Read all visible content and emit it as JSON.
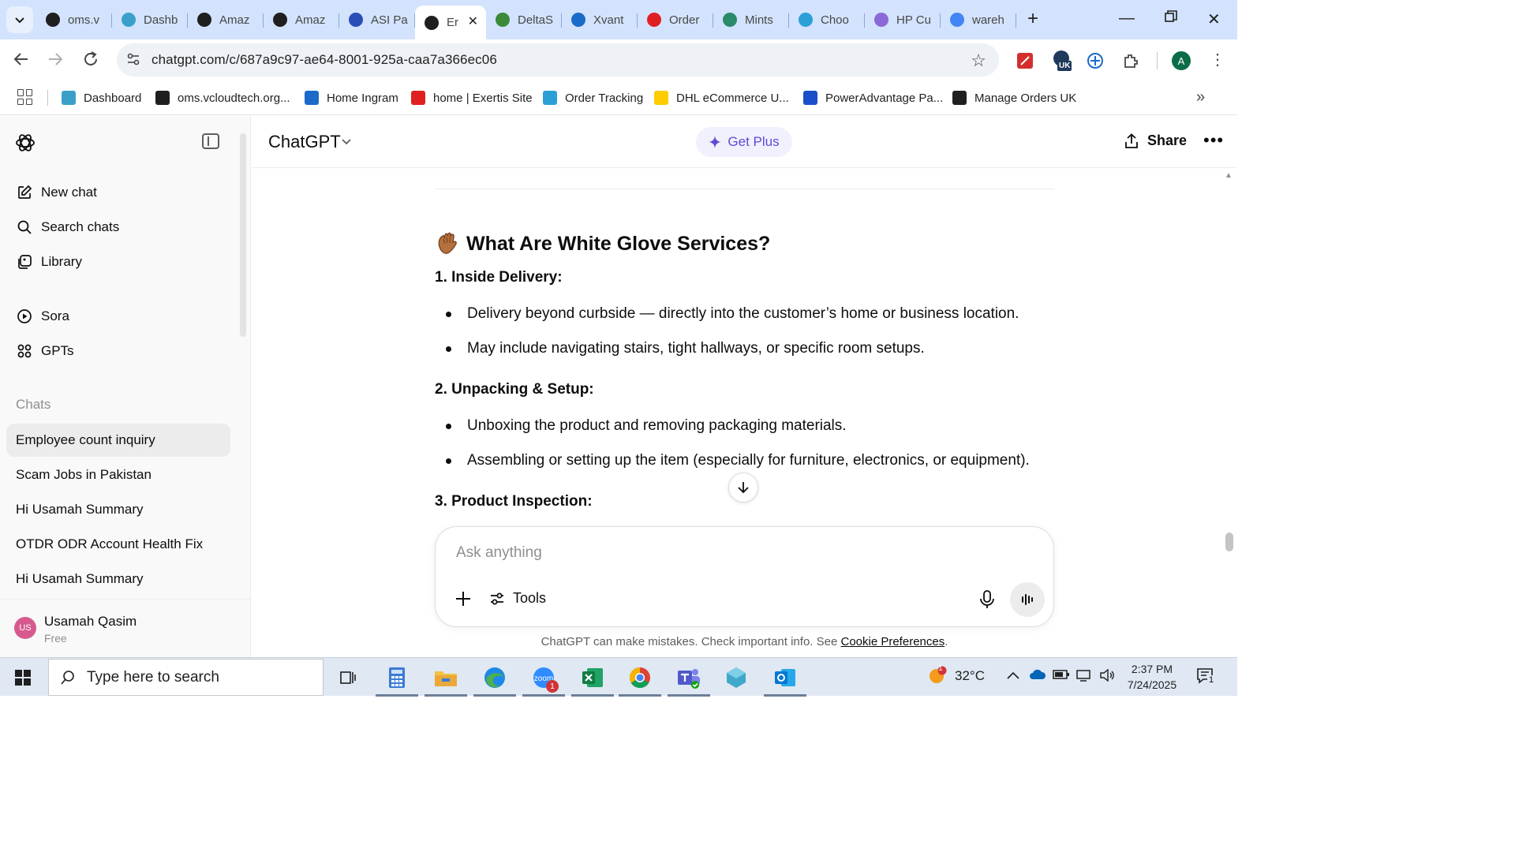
{
  "browser": {
    "tabs": [
      {
        "label": "oms.v",
        "icon": "oms-icon",
        "color": "#1f1f1f"
      },
      {
        "label": "Dashb",
        "icon": "dashboard-icon",
        "color": "#3ba0c9"
      },
      {
        "label": "Amaz",
        "icon": "amazon-icon",
        "color": "#1f1f1f"
      },
      {
        "label": "Amaz",
        "icon": "amazon-icon",
        "color": "#1f1f1f"
      },
      {
        "label": "ASI Pa",
        "icon": "asi-icon",
        "color": "#2a4db8"
      },
      {
        "label": "Er",
        "icon": "chatgpt-icon",
        "color": "#1f1f1f",
        "active": true
      },
      {
        "label": "DeltaS",
        "icon": "deltas-icon",
        "color": "#3a8a3a"
      },
      {
        "label": "Xvant",
        "icon": "xvant-icon",
        "color": "#1b6ac9"
      },
      {
        "label": "Order",
        "icon": "exertis-icon",
        "color": "#e02020"
      },
      {
        "label": "Mints",
        "icon": "mints-icon",
        "color": "#2a8a6a"
      },
      {
        "label": "Choo",
        "icon": "choo-icon",
        "color": "#2aa0d6"
      },
      {
        "label": "HP Cu",
        "icon": "hp-icon",
        "color": "#8a6ad6"
      },
      {
        "label": "wareh",
        "icon": "google-icon",
        "color": "#4285f4"
      }
    ],
    "url": "chatgpt.com/c/687a9c97-ae64-8001-925a-caa7a366ec06",
    "profile_initial": "A",
    "ext_badge": "UK",
    "bookmarks": [
      {
        "label": "Dashboard",
        "color": "#3ba0c9"
      },
      {
        "label": "oms.vcloudtech.org...",
        "color": "#1f1f1f"
      },
      {
        "label": "Home Ingram",
        "color": "#1b6ac9"
      },
      {
        "label": "home | Exertis Site",
        "color": "#e02020"
      },
      {
        "label": "Order Tracking",
        "color": "#2aa0d6"
      },
      {
        "label": "DHL eCommerce U...",
        "color": "#ffcc00"
      },
      {
        "label": "PowerAdvantage Pa...",
        "color": "#1b4fc9"
      },
      {
        "label": "Manage Orders UK",
        "color": "#1f1f1f"
      }
    ]
  },
  "sidebar": {
    "items": [
      {
        "label": "New chat",
        "icon": "compose-icon"
      },
      {
        "label": "Search chats",
        "icon": "search-icon"
      },
      {
        "label": "Library",
        "icon": "library-icon"
      },
      {
        "label": "Sora",
        "icon": "play-icon"
      },
      {
        "label": "GPTs",
        "icon": "grid-icon"
      }
    ],
    "chats_heading": "Chats",
    "chats": [
      "Employee count inquiry",
      "Scam Jobs in Pakistan",
      "Hi Usamah Summary",
      "OTDR ODR Account Health Fix",
      "Hi Usamah Summary"
    ],
    "user": {
      "initials": "US",
      "name": "Usamah Qasim",
      "plan": "Free"
    }
  },
  "header": {
    "model": "ChatGPT",
    "get_plus": "Get Plus",
    "share": "Share"
  },
  "content": {
    "heading": "What Are White Glove Services?",
    "sections": [
      {
        "title": "1. Inside Delivery:",
        "bullets": [
          "Delivery beyond curbside — directly into the customer’s home or business location.",
          "May include navigating stairs, tight hallways, or specific room setups."
        ]
      },
      {
        "title": "2. Unpacking & Setup:",
        "bullets": [
          "Unboxing the product and removing packaging materials.",
          "Assembling or setting up the item (especially for furniture, electronics, or equipment)."
        ]
      },
      {
        "title": "3. Product Inspection:",
        "bullets": []
      }
    ]
  },
  "composer": {
    "placeholder": "Ask anything",
    "tools_label": "Tools"
  },
  "disclaimer": {
    "text": "ChatGPT can make mistakes. Check important info. See ",
    "link": "Cookie Preferences",
    "end": "."
  },
  "taskbar": {
    "search_placeholder": "Type here to search",
    "temperature": "32°C",
    "weather_badge": "1",
    "time": "2:37 PM",
    "date": "7/24/2025",
    "zoom_badge": "1",
    "notifications": "1"
  }
}
